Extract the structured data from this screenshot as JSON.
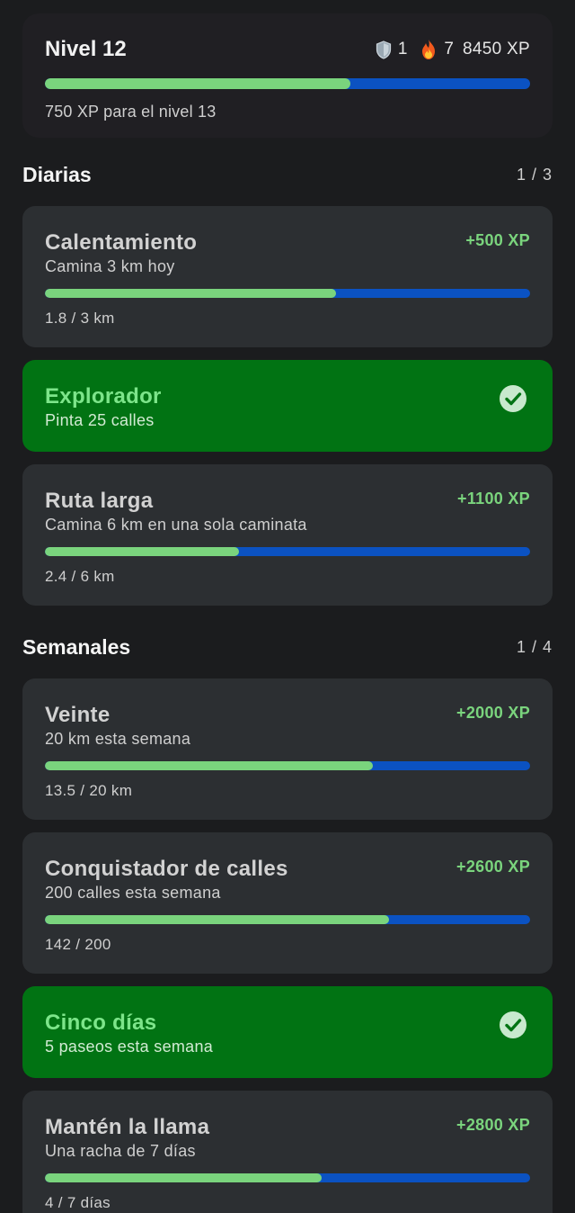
{
  "header": {
    "level_label": "Nivel 12",
    "shields": "1",
    "streak": "7",
    "total_xp": "8450 XP",
    "level_progress": 0.63,
    "next_level_text": "750 XP para el nivel 13"
  },
  "daily": {
    "title": "Diarias",
    "count": "1 / 3",
    "missions": [
      {
        "title": "Calentamiento",
        "desc": "Camina 3 km hoy",
        "reward": "+500 XP",
        "progress_text": "1.8 / 3 km",
        "progress": 0.6,
        "done": false
      },
      {
        "title": "Explorador",
        "desc": "Pinta 25 calles",
        "done": true
      },
      {
        "title": "Ruta larga",
        "desc": "Camina 6 km en una sola caminata",
        "reward": "+1100 XP",
        "progress_text": "2.4 / 6 km",
        "progress": 0.4,
        "done": false
      }
    ]
  },
  "weekly": {
    "title": "Semanales",
    "count": "1 / 4",
    "missions": [
      {
        "title": "Veinte",
        "desc": "20 km esta semana",
        "reward": "+2000 XP",
        "progress_text": "13.5 / 20 km",
        "progress": 0.675,
        "done": false
      },
      {
        "title": "Conquistador de calles",
        "desc": "200 calles esta semana",
        "reward": "+2600 XP",
        "progress_text": "142 / 200",
        "progress": 0.71,
        "done": false
      },
      {
        "title": "Cinco días",
        "desc": "5 paseos esta semana",
        "done": true
      },
      {
        "title": "Mantén la llama",
        "desc": "Una racha de 7 días",
        "reward": "+2800 XP",
        "progress_text": "4 / 7 días",
        "progress": 0.571,
        "done": false
      }
    ]
  },
  "colors": {
    "background": "#1b1c1e",
    "card": "#2c2f32",
    "done_card": "#017313",
    "progress_fill": "#7ad47d",
    "progress_track": "#0b52c2"
  }
}
